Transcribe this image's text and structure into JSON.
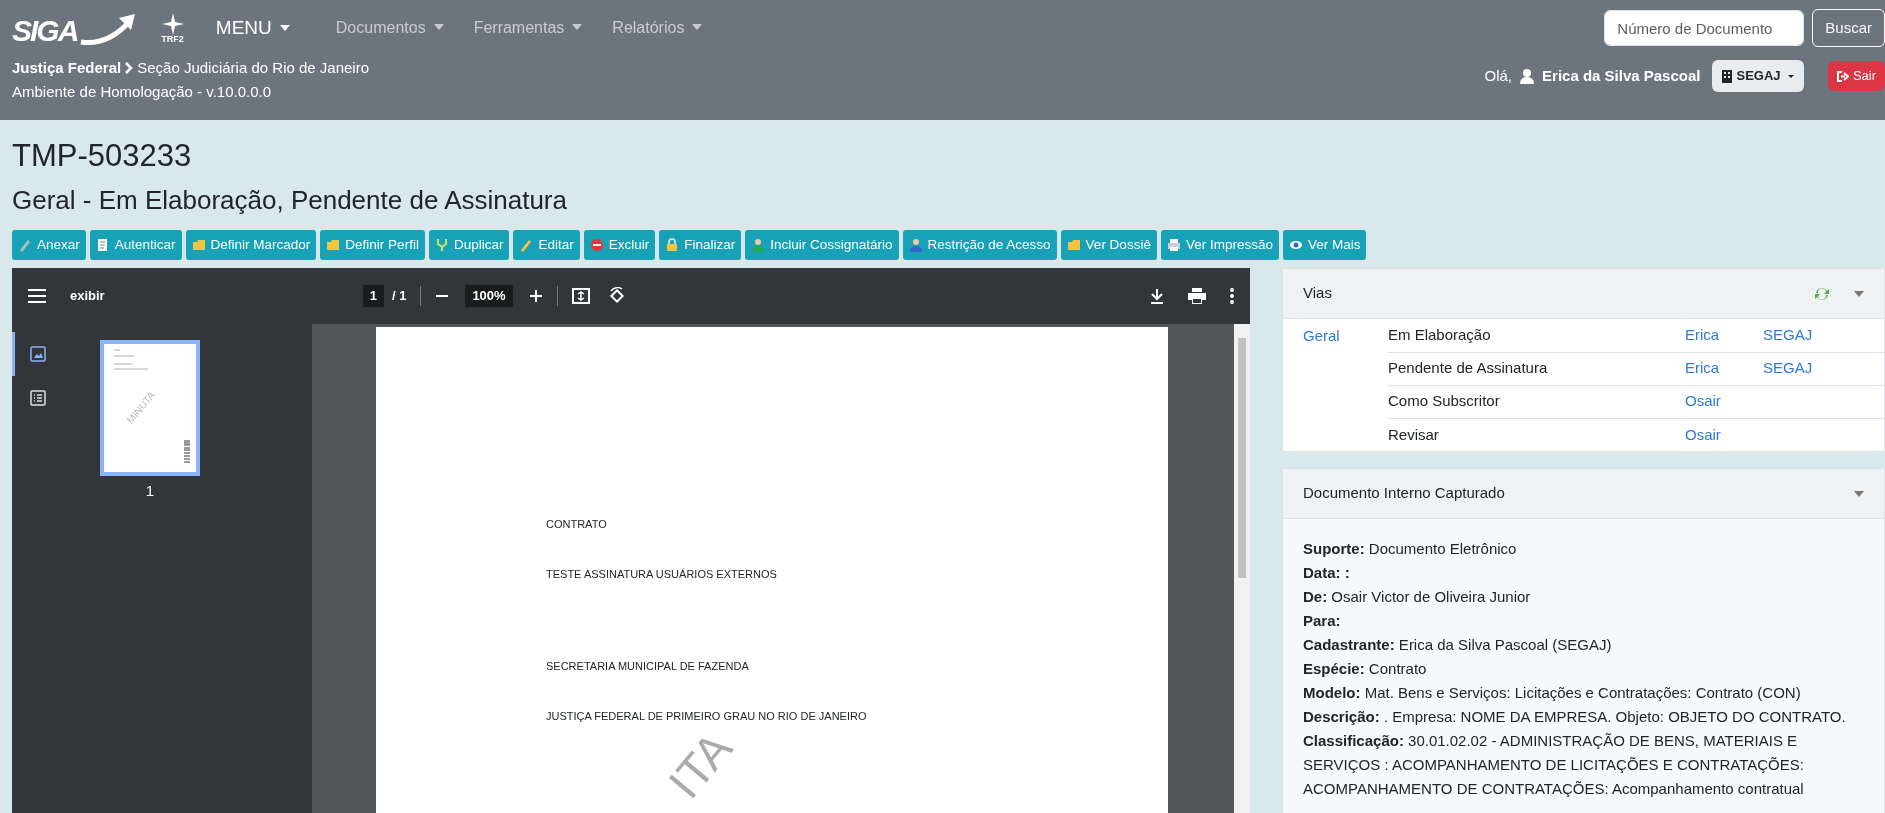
{
  "header": {
    "logo": "SIGA",
    "org_logo": "TRF2",
    "menus": [
      {
        "label": "MENU",
        "kind": "main"
      },
      {
        "label": "Documentos",
        "kind": "link"
      },
      {
        "label": "Ferramentas",
        "kind": "link"
      },
      {
        "label": "Relatórios",
        "kind": "link"
      }
    ],
    "search": {
      "placeholder": "Número de Documento",
      "button": "Buscar"
    },
    "breadcrumb": [
      "Justiça Federal",
      "Seção Judiciária do Rio de Janeiro"
    ],
    "environment": "Ambiente de Homologação - v.10.0.0.0",
    "user": {
      "greeting": "Olá,",
      "name": "Erica da Silva Pascoal",
      "unit": "SEGAJ",
      "logout": "Sair"
    }
  },
  "document": {
    "code": "TMP-503233",
    "status": "Geral - Em Elaboração, Pendente de Assinatura"
  },
  "actions": [
    {
      "label": "Anexar"
    },
    {
      "label": "Autenticar"
    },
    {
      "label": "Definir Marcador"
    },
    {
      "label": "Definir Perfil"
    },
    {
      "label": "Duplicar"
    },
    {
      "label": "Editar"
    },
    {
      "label": "Excluir"
    },
    {
      "label": "Finalizar"
    },
    {
      "label": "Incluir Cossignatário"
    },
    {
      "label": "Restrição de Acesso"
    },
    {
      "label": "Ver Dossiê"
    },
    {
      "label": "Ver Impressão"
    },
    {
      "label": "Ver Mais"
    }
  ],
  "viewer": {
    "title": "exibir",
    "page": "1",
    "page_count": "/ 1",
    "zoom": "100%",
    "sidebar_tabs": [
      {
        "kind": "thumbnails",
        "selected": true
      },
      {
        "kind": "outline",
        "selected": false
      }
    ],
    "thumbnails": [
      {
        "label": "1",
        "selected": true,
        "watermark": "MINUTA"
      }
    ],
    "page_blocks": [
      [
        "CONTRATO",
        "TESTE ASSINATURA USUÁRIOS EXTERNOS"
      ],
      [
        "SECRETARIA MUNICIPAL DE FAZENDA",
        "JUSTIÇA FEDERAL DE PRIMEIRO GRAU NO RIO DE JANEIRO"
      ]
    ],
    "watermark": "ITA"
  },
  "vias": {
    "title": "Vias",
    "groups": [
      {
        "label": "Geral",
        "rows": [
          {
            "status": "Em Elaboração",
            "person": "Erica",
            "unit": "SEGAJ"
          },
          {
            "status": "Pendente de Assinatura",
            "person": "Erica",
            "unit": "SEGAJ"
          },
          {
            "status": "Como Subscritor",
            "person": "Osair"
          },
          {
            "status": "Revisar",
            "person": "Osair"
          }
        ]
      }
    ]
  },
  "details": {
    "title": "Documento Interno Capturado",
    "fields": [
      "**Suporte:** Documento Eletrônico",
      "**Data: :**",
      "**De:** Osair Victor de Oliveira Junior",
      "**Para:**",
      "**Cadastrante:** Erica da Silva Pascoal (SEGAJ)",
      "**Espécie:** Contrato",
      "**Modelo:** Mat. Bens e Serviços: Licitações e Contratações: Contrato (CON)",
      "**Descrição:** . Empresa: NOME DA EMPRESA. Objeto: OBJETO DO CONTRATO.",
      "**Classificação:** 30.01.02.02 - ADMINISTRAÇÃO DE BENS, MATERIAIS E SERVIÇOS : ACOMPANHAMENTO DE LICITAÇÕES E CONTRATAÇÕES: ACOMPANHAMENTO DE CONTRATAÇÕES: Acompanhamento contratual"
    ]
  }
}
